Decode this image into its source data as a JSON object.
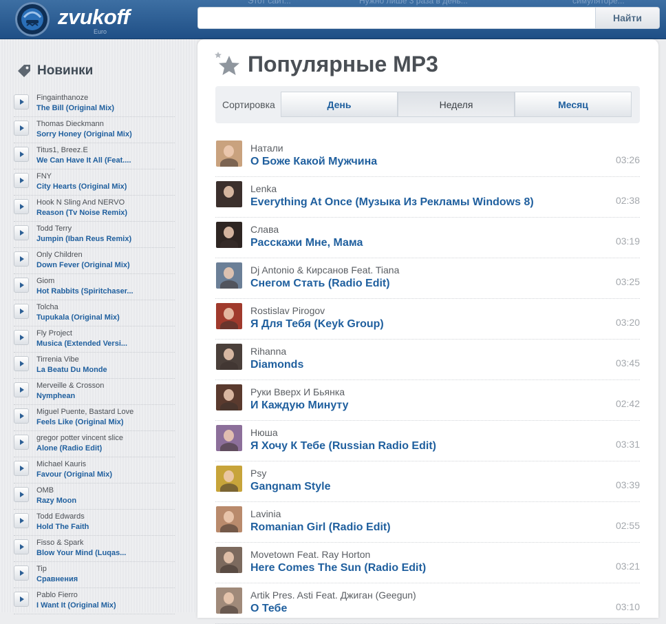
{
  "header": {
    "logo_text": "zvukoff",
    "logo_sub": "Euro",
    "search_placeholder": "",
    "search_button": "Найти",
    "ghost_links": [
      "Этот сайт...",
      "Нужно лише 3 раза в день...",
      "симуляторе..."
    ]
  },
  "sidebar": {
    "title": "Новинки",
    "items": [
      {
        "artist": "Fingainthanoze",
        "track": "The Bill (Original Mix)"
      },
      {
        "artist": "Thomas Dieckmann",
        "track": "Sorry Honey (Original Mix)"
      },
      {
        "artist": "Titus1, Breez.E",
        "track": "We Can Have It All (Feat...."
      },
      {
        "artist": "FNY",
        "track": "City Hearts (Original Mix)"
      },
      {
        "artist": "Hook N Sling And NERVO",
        "track": "Reason (Tv Noise Remix)"
      },
      {
        "artist": "Todd Terry",
        "track": "Jumpin (Iban Reus Remix)"
      },
      {
        "artist": "Only Children",
        "track": "Down Fever (Original Mix)"
      },
      {
        "artist": "Giom",
        "track": "Hot Rabbits (Spiritchaser..."
      },
      {
        "artist": "Tolcha",
        "track": "Tupukala (Original Mix)"
      },
      {
        "artist": "Fly Project",
        "track": "Musica (Extended Versi..."
      },
      {
        "artist": "Tirrenia Vibe",
        "track": "La Beatu Du Monde"
      },
      {
        "artist": "Merveille & Crosson",
        "track": "Nymphean"
      },
      {
        "artist": "Miguel Puente, Bastard Love",
        "track": "Feels Like (Original Mix)"
      },
      {
        "artist": "gregor potter vincent slice",
        "track": "Alone (Radio Edit)"
      },
      {
        "artist": "Michael Kauris",
        "track": "Favour (Original Mix)"
      },
      {
        "artist": "OMB",
        "track": "Razy Moon"
      },
      {
        "artist": "Todd Edwards",
        "track": "Hold The Faith"
      },
      {
        "artist": "Fisso & Spark",
        "track": "Blow Your Mind (Luqas..."
      },
      {
        "artist": "Tip",
        "track": "Сравнения"
      },
      {
        "artist": "Pablo Fierro",
        "track": "I Want It (Original Mix)"
      }
    ]
  },
  "main": {
    "title": "Популярные MP3",
    "sort": {
      "label": "Сортировка",
      "tabs": [
        "День",
        "Неделя",
        "Месяц"
      ],
      "active": "Неделя"
    },
    "tracks": [
      {
        "artist": "Натали",
        "title": "О Боже Какой Мужчина",
        "duration": "03:26",
        "thumb": "#c9a27e"
      },
      {
        "artist": "Lenka",
        "title": "Everything At Once (Музыка Из Рекламы Windows 8)",
        "duration": "02:38",
        "thumb": "#3b2f2c"
      },
      {
        "artist": "Слава",
        "title": "Расскажи Мне, Мама",
        "duration": "03:19",
        "thumb": "#2e2522"
      },
      {
        "artist": "Dj Antonio & Кирсанов Feat. Tiana",
        "title": "Снегом Стать (Radio Edit)",
        "duration": "03:25",
        "thumb": "#6b7f97"
      },
      {
        "artist": "Rostislav Pirogov",
        "title": "Я Для Тебя (Keyk Group)",
        "duration": "03:20",
        "thumb": "#a03a2c"
      },
      {
        "artist": "Rihanna",
        "title": "Diamonds",
        "duration": "03:45",
        "thumb": "#4a3f3a"
      },
      {
        "artist": "Руки Вверх И Бьянка",
        "title": "И Каждую Минуту",
        "duration": "02:42",
        "thumb": "#5a3a2e"
      },
      {
        "artist": "Нюша",
        "title": "Я Хочу К Тебе (Russian Radio Edit)",
        "duration": "03:31",
        "thumb": "#8c6f9a"
      },
      {
        "artist": "Psy",
        "title": "Gangnam Style",
        "duration": "03:39",
        "thumb": "#c7a43a"
      },
      {
        "artist": "Lavinia",
        "title": "Romanian Girl (Radio Edit)",
        "duration": "02:55",
        "thumb": "#b98a6c"
      },
      {
        "artist": "Movetown Feat. Ray Horton",
        "title": "Here Comes The Sun (Radio Edit)",
        "duration": "03:21",
        "thumb": "#7c6a5e"
      },
      {
        "artist": "Artik Pres. Asti Feat. Джиган (Geegun)",
        "title": "О Тебе",
        "duration": "03:10",
        "thumb": "#a08a7a"
      }
    ]
  }
}
